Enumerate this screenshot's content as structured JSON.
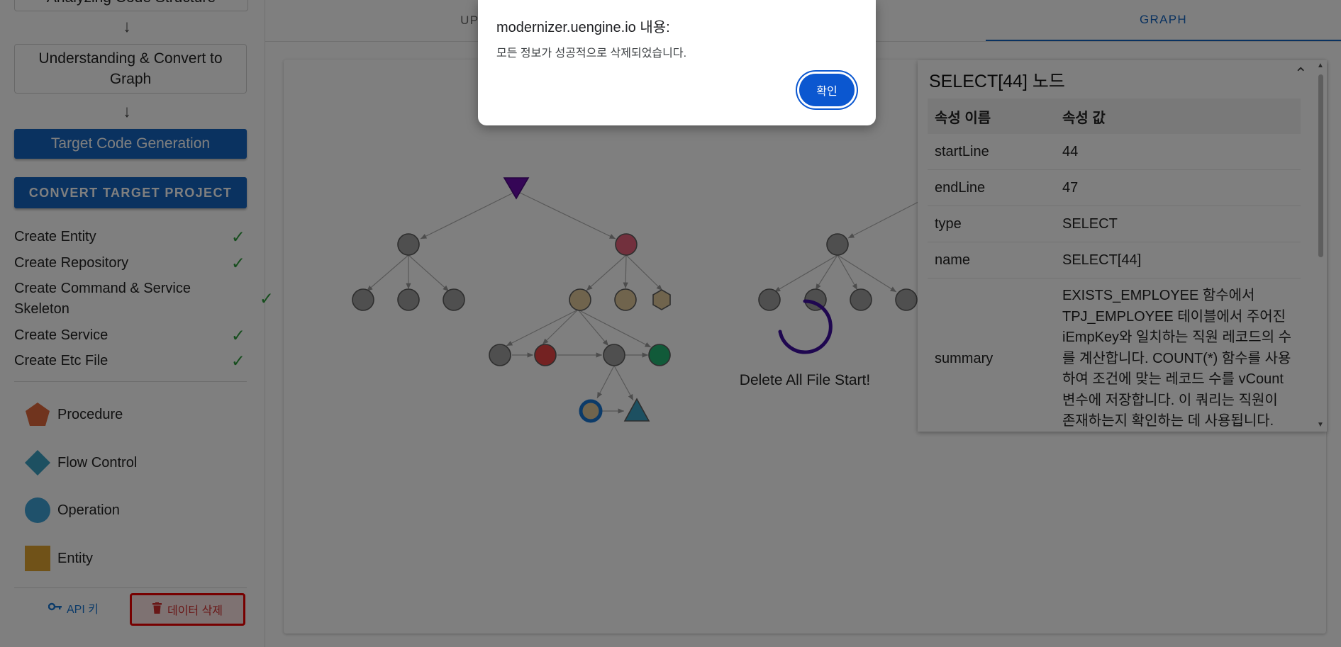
{
  "sidebar": {
    "step_analyzing": "Analyzing Code Structure",
    "step_understanding": "Understanding & Convert to Graph",
    "step_target": "Target Code Generation",
    "convert_button": "CONVERT TARGET PROJECT",
    "tasks": [
      {
        "label": "Create Entity",
        "done": true
      },
      {
        "label": "Create Repository",
        "done": true
      },
      {
        "label": "Create Command & Service Skeleton",
        "done": true
      },
      {
        "label": "Create Service",
        "done": true
      },
      {
        "label": "Create Etc File",
        "done": true
      }
    ],
    "legend": [
      {
        "label": "Procedure",
        "shape": "pentagon",
        "color": "#e0693c"
      },
      {
        "label": "Flow Control",
        "shape": "diamond",
        "color": "#3aa0c2"
      },
      {
        "label": "Operation",
        "shape": "circle",
        "color": "#3fa2d6"
      },
      {
        "label": "Entity",
        "shape": "square",
        "color": "#e0a530"
      }
    ],
    "api_key_label": "API 키",
    "delete_data_label": "데이터 삭제"
  },
  "tabs": [
    {
      "label": "UPLOAD",
      "active": false
    },
    {
      "label": "GRAPH",
      "active": true
    }
  ],
  "graph": {
    "status_text": "Delete All File Start!"
  },
  "node_panel": {
    "title": "SELECT[44] 노드",
    "header_name": "속성 이름",
    "header_value": "속성 값",
    "rows": [
      {
        "name": "startLine",
        "value": "44"
      },
      {
        "name": "endLine",
        "value": "47"
      },
      {
        "name": "type",
        "value": "SELECT"
      },
      {
        "name": "name",
        "value": "SELECT[44]"
      },
      {
        "name": "summary",
        "value": "EXISTS_EMPLOYEE 함수에서 TPJ_EMPLOYEE 테이블에서 주어진 iEmpKey와 일치하는 직원 레코드의 수를 계산합니다. COUNT(*) 함수를 사용하여 조건에 맞는 레코드 수를 vCount 변수에 저장합니다. 이 쿼리는 직원이 존재하는지 확인하는 데 사용됩니다."
      }
    ]
  },
  "dialog": {
    "title": "modernizer.uengine.io 내용:",
    "message": "모든 정보가 성공적으로 삭제되었습니다.",
    "ok_label": "확인"
  },
  "colors": {
    "primary": "#1565c0",
    "check": "#2e9d3c",
    "danger": "#d32f2f",
    "dialog_button": "#0b57d0"
  }
}
